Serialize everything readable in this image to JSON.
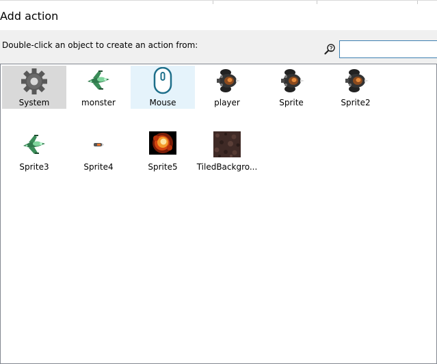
{
  "dialog": {
    "title": "Add action",
    "prompt": "Double-click an object to create an action from:",
    "search": {
      "value": "",
      "placeholder": ""
    }
  },
  "objects": [
    {
      "label": "System",
      "icon": "gear-icon",
      "state": "selected"
    },
    {
      "label": "monster",
      "icon": "green-ship-sprite-icon",
      "state": "normal"
    },
    {
      "label": "Mouse",
      "icon": "mouse-icon",
      "state": "hovered"
    },
    {
      "label": "player",
      "icon": "dark-ship-sprite-icon",
      "state": "normal"
    },
    {
      "label": "Sprite",
      "icon": "dark-ship-sprite-icon",
      "state": "normal"
    },
    {
      "label": "Sprite2",
      "icon": "dark-ship-sprite-icon",
      "state": "normal"
    },
    {
      "label": "Sprite3",
      "icon": "green-ship-sprite-icon",
      "state": "normal"
    },
    {
      "label": "Sprite4",
      "icon": "bullet-sprite-icon",
      "state": "normal"
    },
    {
      "label": "Sprite5",
      "icon": "explosion-sprite-icon",
      "state": "normal"
    },
    {
      "label": "TiledBackgro...",
      "icon": "rocky-texture-icon",
      "state": "normal"
    }
  ],
  "colors": {
    "selected": "#d9d9d9",
    "hovered": "#e5f3fb",
    "search_border": "#3c7fb1"
  }
}
